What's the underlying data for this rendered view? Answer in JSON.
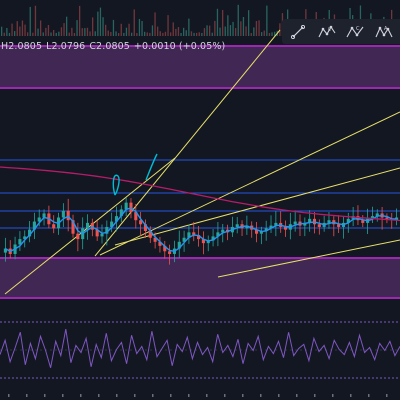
{
  "legend": {
    "high": "H2.0805",
    "low": "L2.0796",
    "close": "C2.0805",
    "change": "+0.0010 (+0.05%)"
  },
  "drawing_toolbar": {
    "tools": [
      {
        "icon": "trend-line-icon"
      },
      {
        "icon": "pattern-xabcd-icon"
      },
      {
        "icon": "pattern-abcd-icon"
      },
      {
        "icon": "pattern-triangle-icon"
      }
    ]
  },
  "colors": {
    "background": "#131722",
    "candle_up": "#26a69a",
    "candle_down": "#ef5350",
    "zone_fill": "#4a2a5c",
    "zone_border": "#9c27b0",
    "trend_line": "#e8e06a",
    "horizontal_line": "#2962ff",
    "ma_fast": "#2196f3",
    "ma_slow": "#b71c6a",
    "oscillator": "#7e57c2",
    "freehand": "#00bcd4"
  },
  "chart_data": [
    {
      "type": "candlestick",
      "y_range": [
        2.0745,
        2.0845
      ],
      "series": [
        {
          "name": "",
          "closes": [
            2.0772,
            2.0768,
            2.0775,
            2.0779,
            2.0781,
            2.0786,
            2.0792,
            2.0795,
            2.0798,
            2.079,
            2.0787,
            2.0795,
            2.08,
            2.0793,
            2.0783,
            2.0779,
            2.0787,
            2.0791,
            2.0786,
            2.0781,
            2.0783,
            2.0788,
            2.0792,
            2.0796,
            2.0801,
            2.0806,
            2.0799,
            2.0793,
            2.079,
            2.0785,
            2.078,
            2.0777,
            2.0774,
            2.077,
            2.0768,
            2.0772,
            2.0777,
            2.078,
            2.0784,
            2.0782,
            2.0779,
            2.0776,
            2.0778,
            2.0781,
            2.0784,
            2.0786,
            2.0784,
            2.0788,
            2.079,
            2.0787,
            2.0789,
            2.0786,
            2.0783,
            2.0785,
            2.0787,
            2.0789,
            2.0791,
            2.0788,
            2.0786,
            2.079,
            2.0792,
            2.0789,
            2.0791,
            2.0794,
            2.079,
            2.0788,
            2.0791,
            2.0793,
            2.079,
            2.0788,
            2.0791,
            2.0794,
            2.0796,
            2.0793,
            2.0791,
            2.0794,
            2.0796,
            2.0798,
            2.0795,
            2.0794,
            2.0793,
            2.0795
          ]
        }
      ]
    },
    {
      "type": "line",
      "series": [
        {
          "name": "",
          "values": [
            48,
            62,
            41,
            55,
            70,
            38,
            59,
            44,
            66,
            52,
            35,
            61,
            47,
            73,
            40,
            57,
            50,
            64,
            36,
            58,
            45,
            69,
            42,
            53,
            60,
            39,
            67,
            49,
            56,
            43,
            71,
            46,
            54,
            62,
            37,
            58,
            51,
            65,
            44,
            60,
            48,
            55,
            41,
            68,
            50,
            57,
            46,
            63,
            39,
            59,
            52,
            66,
            43,
            56,
            49,
            61,
            45,
            70,
            47,
            54,
            58,
            42,
            64,
            51,
            57,
            44,
            62,
            53,
            48,
            60,
            46,
            67,
            50,
            55,
            43,
            59,
            52,
            61,
            47,
            56
          ]
        }
      ]
    }
  ]
}
